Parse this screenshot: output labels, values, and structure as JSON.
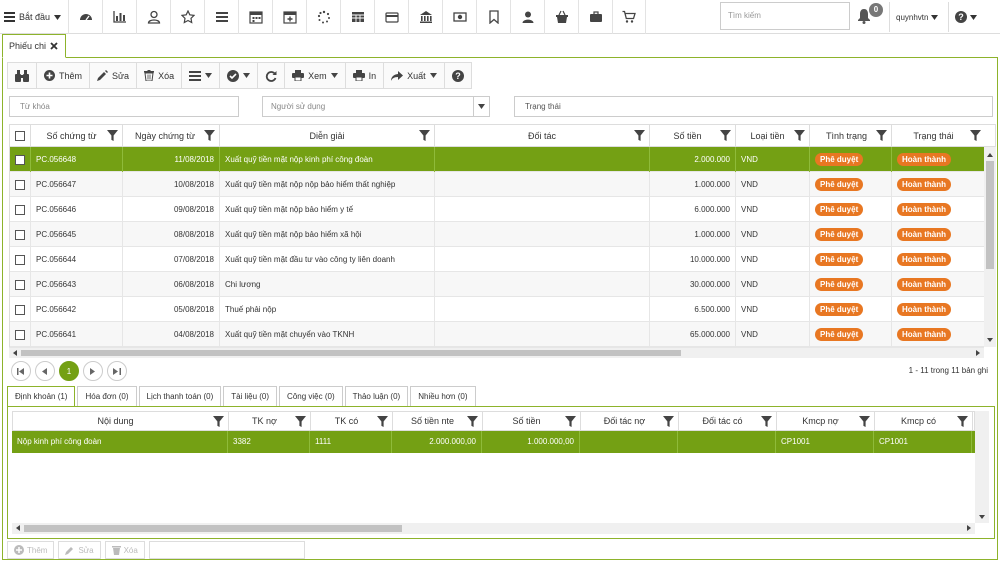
{
  "topbar": {
    "start_label": "Bắt đầu",
    "icons": [
      "dashboard-icon",
      "bar-chart-icon",
      "user-outline-icon",
      "star-icon",
      "list-icon",
      "calendar-icon",
      "calendar-plus-icon",
      "spinner-icon",
      "grid-table-icon",
      "credit-card-icon",
      "bank-icon",
      "money-icon",
      "bookmark-icon",
      "user-icon",
      "basket-icon",
      "briefcase-icon",
      "cart-icon"
    ],
    "search_placeholder": "Tìm kiếm",
    "notification_count": "0",
    "username": "quynhvtn"
  },
  "tab": {
    "label": "Phiếu chi"
  },
  "toolbar": {
    "add": "Thêm",
    "edit": "Sửa",
    "delete": "Xóa",
    "view": "Xem",
    "print": "In",
    "export": "Xuất"
  },
  "filters": {
    "keyword_placeholder": "Từ khóa",
    "user_placeholder": "Người sử dụng",
    "status_placeholder": "Trạng thái"
  },
  "grid": {
    "columns": [
      "Số chứng từ",
      "Ngày chứng từ",
      "Diễn giải",
      "Đối tác",
      "Số tiền",
      "Loại tiền",
      "Tình trạng",
      "Trạng thái"
    ],
    "rows": [
      {
        "so": "PC.056648",
        "ngay": "11/08/2018",
        "dien_giai": "Xuất quỹ tiền mặt nộp kinh phí công đoàn",
        "doi_tac": "",
        "so_tien": "2.000.000",
        "loai": "VND",
        "tinh_trang": "Phê duyệt",
        "trang_thai": "Hoàn thành"
      },
      {
        "so": "PC.056647",
        "ngay": "10/08/2018",
        "dien_giai": "Xuất quỹ tiền mặt nộp nộp bảo hiểm thất nghiệp",
        "doi_tac": "",
        "so_tien": "1.000.000",
        "loai": "VND",
        "tinh_trang": "Phê duyệt",
        "trang_thai": "Hoàn thành"
      },
      {
        "so": "PC.056646",
        "ngay": "09/08/2018",
        "dien_giai": "Xuất quỹ tiền mặt nộp bảo hiểm y tế",
        "doi_tac": "",
        "so_tien": "6.000.000",
        "loai": "VND",
        "tinh_trang": "Phê duyệt",
        "trang_thai": "Hoàn thành"
      },
      {
        "so": "PC.056645",
        "ngay": "08/08/2018",
        "dien_giai": "Xuất quỹ tiền mặt nộp bảo hiểm xã hội",
        "doi_tac": "",
        "so_tien": "1.000.000",
        "loai": "VND",
        "tinh_trang": "Phê duyệt",
        "trang_thai": "Hoàn thành"
      },
      {
        "so": "PC.056644",
        "ngay": "07/08/2018",
        "dien_giai": "Xuất quỹ tiền mặt đầu tư vào công ty liên doanh",
        "doi_tac": "",
        "so_tien": "10.000.000",
        "loai": "VND",
        "tinh_trang": "Phê duyệt",
        "trang_thai": "Hoàn thành"
      },
      {
        "so": "PC.056643",
        "ngay": "06/08/2018",
        "dien_giai": "Chi lương",
        "doi_tac": "",
        "so_tien": "30.000.000",
        "loai": "VND",
        "tinh_trang": "Phê duyệt",
        "trang_thai": "Hoàn thành"
      },
      {
        "so": "PC.056642",
        "ngay": "05/08/2018",
        "dien_giai": "Thuế phải nộp",
        "doi_tac": "",
        "so_tien": "6.500.000",
        "loai": "VND",
        "tinh_trang": "Phê duyệt",
        "trang_thai": "Hoàn thành"
      },
      {
        "so": "PC.056641",
        "ngay": "04/08/2018",
        "dien_giai": "Xuất quỹ tiền mặt chuyển vào TKNH",
        "doi_tac": "",
        "so_tien": "65.000.000",
        "loai": "VND",
        "tinh_trang": "Phê duyệt",
        "trang_thai": "Hoàn thành"
      }
    ]
  },
  "pager": {
    "current_page": "1",
    "info": "1 - 11 trong 11 bản ghi"
  },
  "subtabs": [
    "Định khoản (1)",
    "Hóa đơn (0)",
    "Lịch thanh toán (0)",
    "Tài liệu (0)",
    "Công việc (0)",
    "Thảo luận (0)",
    "Nhiều hơn (0)"
  ],
  "subgrid": {
    "columns": [
      "Nội dung",
      "TK nợ",
      "TK có",
      "Số tiền nte",
      "Số tiền",
      "Đối tác nợ",
      "Đối tác có",
      "Kmcp nợ",
      "Kmcp có"
    ],
    "row": {
      "noi_dung": "Nộp kinh phí công đoàn",
      "tk_no": "3382",
      "tk_co": "1111",
      "so_tien_nte": "2.000.000,00",
      "so_tien": "1.000.000,00",
      "doi_tac_no": "",
      "doi_tac_co": "",
      "kmcp_no": "CP1001",
      "kmcp_co": "CP1001"
    }
  },
  "bottombar": {
    "add": "Thêm",
    "edit": "Sửa",
    "delete": "Xóa"
  },
  "colors": {
    "accent": "#74a014",
    "badge": "#e87722"
  }
}
